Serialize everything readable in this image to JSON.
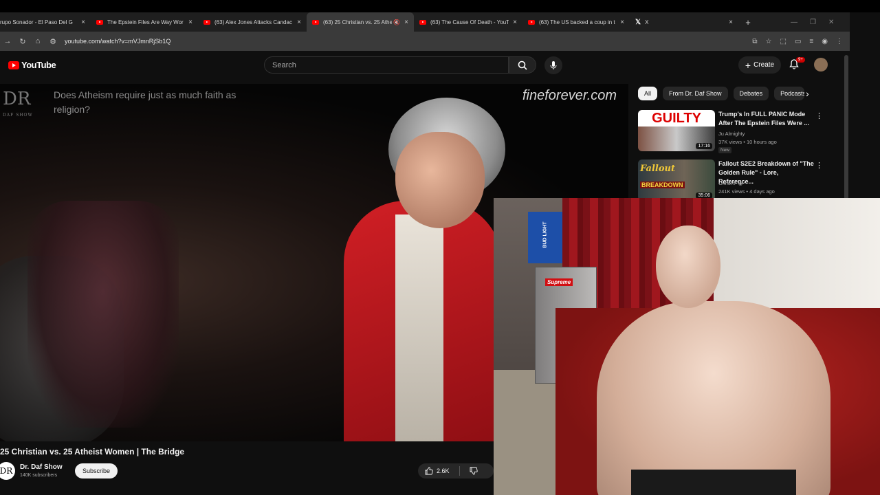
{
  "browser": {
    "tabs": [
      {
        "title": "rupo Sonador - El Paso Del G",
        "active": false
      },
      {
        "title": "The Epstein Files Are Way Wor",
        "active": false
      },
      {
        "title": "(63) Alex Jones Attacks Candac",
        "active": false
      },
      {
        "title": "(63) 25 Christian vs. 25 Athe",
        "active": true
      },
      {
        "title": "(63) The Cause Of Death - YouT",
        "active": false
      },
      {
        "title": "(63) The US backed a coup in t",
        "active": false
      },
      {
        "title": "X",
        "active": false
      }
    ],
    "close_glyph": "×",
    "new_tab_glyph": "+",
    "url": "youtube.com/watch?v=mVJmnRjSb1Q"
  },
  "youtube": {
    "logo_text": "YouTube",
    "search_placeholder": "Search",
    "create_label": "Create",
    "notif_badge": "9+"
  },
  "video": {
    "overlay_logo": "DR",
    "overlay_logo_sub": "DAF SHOW",
    "overlay_question": "Does Atheism require just as much faith as religion?",
    "overlay_site": "fineforever.com",
    "title": "25 Christian vs. 25 Atheist Women | The Bridge",
    "channel_initials": "DR",
    "channel_name": "Dr. Daf Show",
    "channel_subs": "140K subscribers",
    "subscribe_label": "Subscribe",
    "likes": "2.6K"
  },
  "chips": [
    "All",
    "From Dr. Daf Show",
    "Debates",
    "Podcasts"
  ],
  "recommendations": [
    {
      "title": "Trump's In FULL PANIC Mode After The Epstein Files Were ...",
      "channel": "Ju Almighty",
      "meta": "37K views • 10 hours ago",
      "badge": "New",
      "duration": "17:16",
      "thumb_text": "GUILTY"
    },
    {
      "title": "Fallout S2E2 Breakdown of \"The Golden Rule\" - Lore, Reference...",
      "channel": "Oxhorn",
      "meta": "241K views • 4 days ago",
      "duration": "35:06",
      "thumb_text": "BREAKDOWN"
    }
  ],
  "webcam": {
    "visible_text": [
      "BUD LIGHT",
      "Supreme"
    ]
  },
  "colors": {
    "accent": "#ff0000",
    "bg": "#0f0f0f",
    "chip_active": "#f1f1f1"
  }
}
